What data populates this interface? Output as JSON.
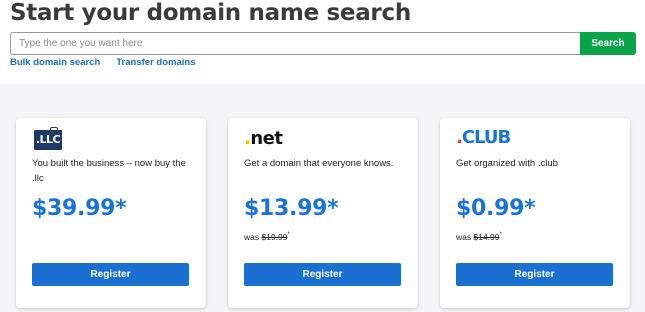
{
  "header": {
    "title": "Start your domain name search"
  },
  "search": {
    "placeholder": "Type the one you want here",
    "value": "",
    "button_label": "Search"
  },
  "links": {
    "bulk": "Bulk domain search",
    "transfer": "Transfer domains"
  },
  "colors": {
    "search_button": "#09a34a",
    "price": "#1a73d9",
    "register_button": "#1a6fd0"
  },
  "cards": [
    {
      "logo_text": ".LLC",
      "description": "You built the business – now buy the .llc",
      "price": "$39.99*",
      "was_label": "",
      "was_price": "",
      "button_label": "Register"
    },
    {
      "logo_text": ".net",
      "description": "Get a domain that everyone knows.",
      "price": "$13.99*",
      "was_label": "was",
      "was_price": "$19.99",
      "was_marker": "*",
      "button_label": "Register"
    },
    {
      "logo_text": ".CLUB",
      "description": "Get organized with .club",
      "price": "$0.99*",
      "was_label": "was",
      "was_price": "$14.99",
      "was_marker": "*",
      "button_label": "Register"
    }
  ]
}
